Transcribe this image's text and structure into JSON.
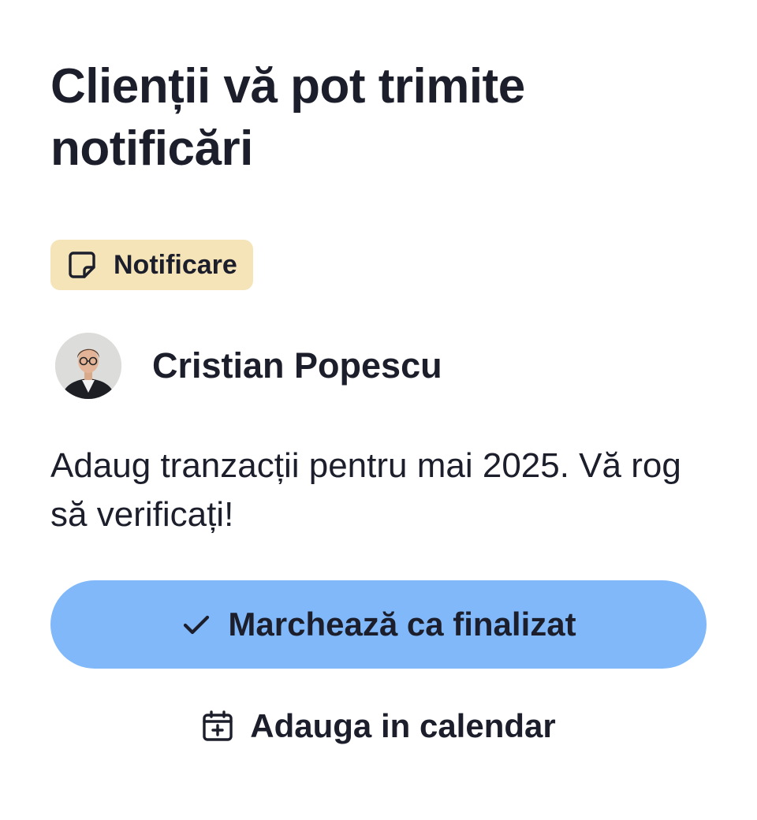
{
  "header": {
    "title": "Clienții vă pot trimite notificări"
  },
  "badge": {
    "label": "Notificare",
    "icon": "sticky-note-icon",
    "background": "#f5e4b8"
  },
  "message_card": {
    "author_name": "Cristian Popescu",
    "avatar": "avatar-photo",
    "text": "Adaug tranzacții pentru mai 2025. Vă rog să verificați!"
  },
  "actions": {
    "mark_done_label": "Marchează ca finalizat",
    "mark_done_icon": "checkmark-icon",
    "mark_done_color": "#80b8fa",
    "add_calendar_label": "Adauga in calendar",
    "add_calendar_icon": "calendar-plus-icon"
  },
  "colors": {
    "text": "#1c1f2b",
    "background": "#ffffff"
  }
}
